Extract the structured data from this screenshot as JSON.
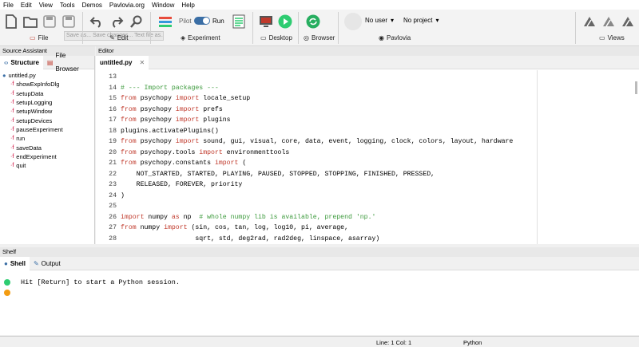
{
  "menu": [
    "File",
    "Edit",
    "View",
    "Tools",
    "Demos",
    "Pavlovia.org",
    "Window",
    "Help"
  ],
  "toolbar": {
    "file_label": "File",
    "edit_label": "Edit",
    "experiment_label": "Experiment",
    "pilot_label": "Pilot",
    "run_label": "Run",
    "desktop_label": "Desktop",
    "browser_label": "Browser",
    "pavlovia_label": "Pavlovia",
    "views_label": "Views",
    "user_select": "No user",
    "project_select": "No project",
    "tooltip": "Save as... Save changes... Text file as..."
  },
  "source_assistant": {
    "header": "Source Assistant",
    "tabs": [
      "Structure",
      "File Browser"
    ],
    "root": "untitled.py",
    "items": [
      "showExpInfoDlg",
      "setupData",
      "setupLogging",
      "setupWindow",
      "setupDevices",
      "pauseExperiment",
      "run",
      "saveData",
      "endExperiment",
      "quit"
    ]
  },
  "editor": {
    "header": "Editor",
    "tab": "untitled.py",
    "lines": [
      {
        "n": "13",
        "t": ""
      },
      {
        "n": "14",
        "t": "# --- Import packages ---"
      },
      {
        "n": "15",
        "t": "from psychopy import locale_setup"
      },
      {
        "n": "16",
        "t": "from psychopy import prefs"
      },
      {
        "n": "17",
        "t": "from psychopy import plugins"
      },
      {
        "n": "18",
        "t": "plugins.activatePlugins()"
      },
      {
        "n": "19",
        "t": "from psychopy import sound, gui, visual, core, data, event, logging, clock, colors, layout, hardware"
      },
      {
        "n": "20",
        "t": "from psychopy.tools import environmenttools"
      },
      {
        "n": "21",
        "t": "from psychopy.constants import ("
      },
      {
        "n": "22",
        "t": "    NOT_STARTED, STARTED, PLAYING, PAUSED, STOPPED, STOPPING, FINISHED, PRESSED,"
      },
      {
        "n": "23",
        "t": "    RELEASED, FOREVER, priority"
      },
      {
        "n": "24",
        "t": ")"
      },
      {
        "n": "25",
        "t": ""
      },
      {
        "n": "26",
        "t": "import numpy as np  # whole numpy lib is available, prepend 'np.'"
      },
      {
        "n": "27",
        "t": "from numpy import (sin, cos, tan, log, log10, pi, average,"
      },
      {
        "n": "28",
        "t": "                   sqrt, std, deg2rad, rad2deg, linspace, asarray)"
      }
    ]
  },
  "shell": {
    "header": "Shelf",
    "tabs": [
      "Shell",
      "Output"
    ],
    "message": "Hit [Return] to start a Python session."
  },
  "status": {
    "position": "Line: 1 Col: 1",
    "language": "Python"
  },
  "colors": {
    "accent": "#2e7d32",
    "keyword": "#c0392b",
    "comment": "#3c9a3c"
  }
}
